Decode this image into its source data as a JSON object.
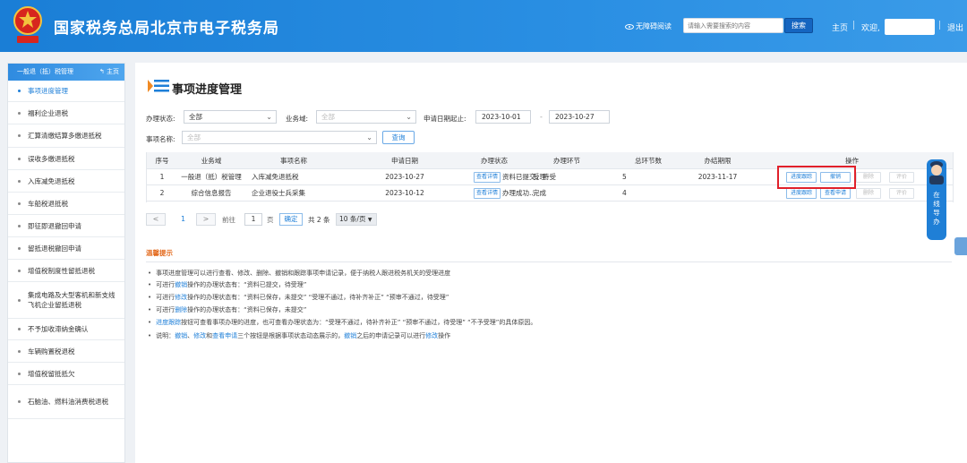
{
  "header": {
    "site_title": "国家税务总局北京市电子税务局",
    "emblem_text": "税",
    "accessibility_label": "无障碍阅读",
    "search_placeholder": "请输入需要搜索的内容",
    "search_button": "搜索",
    "home_link": "主页",
    "welcome": "欢迎,",
    "logout": "退出"
  },
  "sidebar": {
    "section_title": "一般退（抵）税管理",
    "home_link": "主页",
    "items": [
      {
        "label": "事项进度管理",
        "active": true
      },
      {
        "label": "福利企业退税",
        "active": false
      },
      {
        "label": "汇算清缴结算多缴退抵税",
        "active": false
      },
      {
        "label": "误收多缴退抵税",
        "active": false
      },
      {
        "label": "入库减免退抵税",
        "active": false
      },
      {
        "label": "车船税退抵税",
        "active": false
      },
      {
        "label": "即征即退撤回申请",
        "active": false
      },
      {
        "label": "留抵退税撤回申请",
        "active": false
      },
      {
        "label": "增值税制度性留抵退税",
        "active": false
      },
      {
        "label": "集成电路及大型客机和新支线飞机企业留抵退税",
        "active": false
      },
      {
        "label": "不予加收滞纳金确认",
        "active": false
      },
      {
        "label": "车辆购置税退税",
        "active": false
      },
      {
        "label": "增值税留抵抵欠",
        "active": false
      },
      {
        "label": "石脑油、燃料油消费税退税",
        "active": false
      }
    ]
  },
  "main": {
    "page_title": "事项进度管理",
    "filters": {
      "status_label": "办理状态:",
      "status_value": "全部",
      "domain_label": "业务域:",
      "domain_value": "全部",
      "date_label": "申请日期起止:",
      "date_from": "2023-10-01",
      "date_sep": "-",
      "date_to": "2023-10-27",
      "name_label": "事项名称:",
      "name_value": "全部",
      "query_button": "查询"
    },
    "table": {
      "columns": [
        "序号",
        "业务域",
        "事项名称",
        "申请日期",
        "办理状态",
        "办理环节",
        "总环节数",
        "办结期限",
        "操作"
      ],
      "rows": [
        {
          "index": "1",
          "domain": "一般退（抵）税管理",
          "name": "入库减免退抵税",
          "date": "2023-10-27",
          "detail_btn": "查看详情",
          "status": "资料已提交，待受理",
          "stage": "受理",
          "total": "5",
          "deadline": "2023-11-17",
          "actions": [
            {
              "label": "进度跟踪",
              "enabled": true
            },
            {
              "label": "撤销",
              "enabled": true
            },
            {
              "label": "删除",
              "enabled": false
            },
            {
              "label": "评价",
              "enabled": false
            }
          ]
        },
        {
          "index": "2",
          "domain": "综合信息报告",
          "name": "企业退役士兵采集",
          "date": "2023-10-12",
          "detail_btn": "查看详情",
          "status": "办理成功...",
          "stage": "完成",
          "total": "4",
          "deadline": "",
          "actions": [
            {
              "label": "进度跟踪",
              "enabled": true
            },
            {
              "label": "查看申请",
              "enabled": true
            },
            {
              "label": "删除",
              "enabled": false
            },
            {
              "label": "评价",
              "enabled": false
            }
          ]
        }
      ]
    },
    "pagination": {
      "prev": "<",
      "page": "1",
      "next": ">",
      "goto_prefix": "前往",
      "goto_value": "1",
      "goto_suffix": "页",
      "confirm": "确定",
      "total": "共 2 条",
      "page_size": "10 条/页"
    },
    "tips": {
      "title": "温馨提示",
      "lines": [
        [
          "事项进度管理可以进行查看、修改、删除、撤销和跟踪事项申请记录，便于纳税人跟进税务机关的受理进度"
        ],
        [
          "可进行",
          {
            "hl": "撤销"
          },
          "操作的办理状态有：“资料已提交，待受理”"
        ],
        [
          "可进行",
          {
            "hl": "修改"
          },
          "操作的办理状态有：“资料已保存，未提交”  “受理不通过，待补齐补正”  “预审不通过，待受理”"
        ],
        [
          "可进行",
          {
            "hl": "删除"
          },
          "操作的办理状态有：“资料已保存，未提交”"
        ],
        [
          {
            "hl": "进度跟踪"
          },
          "按钮可查看事项办理的进度，也可查看办理状态为：“受理不通过，待补齐补正”  “预审不通过，待受理”  “不予受理”的具体原因。"
        ],
        [
          "说明：",
          {
            "hl": "撤销"
          },
          "、",
          {
            "hl": "修改"
          },
          "和",
          {
            "hl": "查看申请"
          },
          "三个按钮是根据事项状态动态展示的，",
          {
            "hl": "撤销"
          },
          "之后的申请记录可以进行",
          {
            "hl": "修改"
          },
          "操作"
        ]
      ]
    }
  },
  "widget": {
    "online_help": "在线导办"
  },
  "colors": {
    "header_blue": "#2a8fe3",
    "accent": "#1e7fd8",
    "highlight_red": "#e0202a",
    "tip_orange": "#e36b1f"
  }
}
